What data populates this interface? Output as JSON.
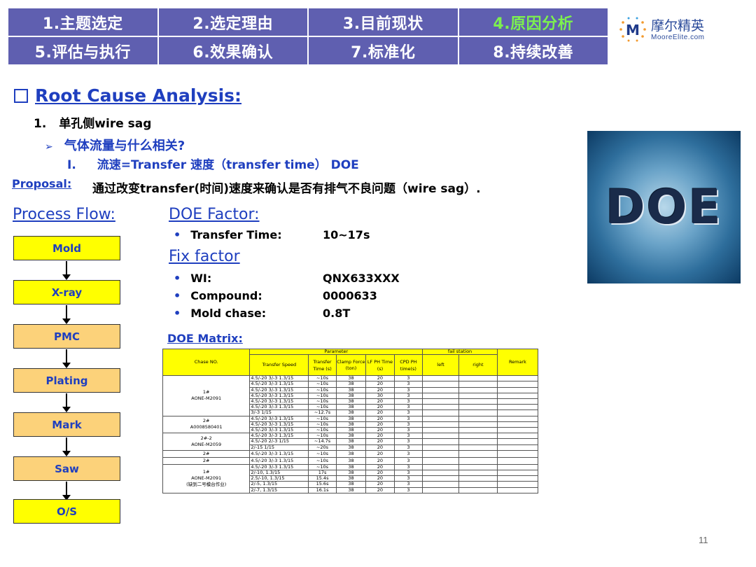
{
  "nav": {
    "row1": [
      "1.主题选定",
      "2.选定理由",
      "3.目前现状",
      "4.原因分析"
    ],
    "row2": [
      "5.评估与执行",
      "6.效果确认",
      "7.标准化",
      "8.持续改善"
    ]
  },
  "brand": {
    "name": "摩尔精英",
    "url": "MooreElite.com",
    "mark": "M"
  },
  "heading": "Root Cause Analysis:",
  "item1": {
    "num": "1.",
    "text": "单孔侧wire sag"
  },
  "item2": {
    "bullet": "➢",
    "text": "气体流量与什么相关?"
  },
  "item3": {
    "num": "I.",
    "text": "流速=Transfer 速度（transfer time） DOE"
  },
  "proposal": {
    "label": "Proposal:",
    "text": "通过改变transfer(时间)速度来确认是否有排气不良问题（wire sag）."
  },
  "doe_image_text": "DOE",
  "process_flow": {
    "title": "Process Flow:",
    "steps": [
      "Mold",
      "X-ray",
      "PMC",
      "Plating",
      "Mark",
      "Saw",
      "O/S"
    ]
  },
  "doe_factor": {
    "title": "DOE Factor:",
    "items": [
      {
        "label": "Transfer Time:",
        "value": "10~17s"
      }
    ]
  },
  "fix_factor": {
    "title": "Fix factor",
    "items": [
      {
        "label": "WI:",
        "value": "QNX633XXX"
      },
      {
        "label": "Compound:",
        "value": "0000633"
      },
      {
        "label": "Mold chase:",
        "value": "0.8T"
      }
    ]
  },
  "matrix": {
    "title": "DOE Matrix:",
    "headers": {
      "chase": "Chase NO.",
      "parameter": "Parameter",
      "fail_station": "fail station",
      "remark": "Remark",
      "transfer_speed": "Transfer Speed",
      "transfer_time": "Transfer Time (s)",
      "clamp_force": "Clamp Force (ton)",
      "lf_ph": "LF PH Time (s)",
      "cpd_ph": "CPD PH time(s)",
      "left": "left",
      "right": "right"
    },
    "chase_groups": [
      {
        "label": "1#\nAONE-M2091",
        "rows": 7
      },
      {
        "label": "2#\nA0008580401",
        "rows": 3
      },
      {
        "label": "2#-2\nAONE-M2059",
        "rows": 3
      },
      {
        "label": "2#",
        "rows": 1
      },
      {
        "label": "2#",
        "rows": 1
      },
      {
        "label": "1#\nAONE-M2091\n(缺到二号模台作业)",
        "rows": 5
      }
    ],
    "rows": [
      [
        "4.5/-20 3/-3 1.3/15",
        "~10s",
        "38",
        "20",
        "3"
      ],
      [
        "4.5/-20 3/-3 1.3/15",
        "~10s",
        "38",
        "20",
        "3"
      ],
      [
        "4.5/-20 3/-3 1.3/15",
        "~10s",
        "38",
        "20",
        "3"
      ],
      [
        "4.5/-20 3/-3 1.3/15",
        "~10s",
        "38",
        "30",
        "3"
      ],
      [
        "4.5/-20 3/-3 1.3/15",
        "~10s",
        "38",
        "20",
        "3"
      ],
      [
        "4.5/-20 3/-3 1.3/15",
        "~10s",
        "38",
        "20",
        "3"
      ],
      [
        "3/-3 1/15",
        "~12.7s",
        "38",
        "20",
        "3"
      ],
      [
        "4.5/-20 3/-3 1.3/15",
        "~10s",
        "38",
        "20",
        "3"
      ],
      [
        "4.5/-20 3/-3 1.3/15",
        "~10s",
        "38",
        "20",
        "3"
      ],
      [
        "4.5/-20 3/-3 1.3/15",
        "~10s",
        "38",
        "20",
        "3"
      ],
      [
        "4.5/-20 3/-3 1.3/15",
        "~10s",
        "38",
        "20",
        "3"
      ],
      [
        "4.5/-20 2/-3 1/15",
        "~14.7s",
        "38",
        "20",
        "3"
      ],
      [
        "2/-15 1/15",
        "~20s",
        "38",
        "20",
        "3"
      ],
      [
        "4.5/-20 3/-3 1.3/15",
        "~10s",
        "38",
        "20",
        "3"
      ],
      [
        "4.5/-20 3/-3 1.3/15",
        "~10s",
        "38",
        "20",
        "3"
      ],
      [
        "4.5/-20 3/-3 1.3/15",
        "~10s",
        "38",
        "20",
        "3"
      ],
      [
        "2/-10, 1.3/15",
        "17s",
        "38",
        "20",
        "3"
      ],
      [
        "2.5/-10, 1.3/15",
        "15.4s",
        "38",
        "20",
        "3"
      ],
      [
        "2/-5, 1.3/15",
        "15.6s",
        "38",
        "20",
        "3"
      ],
      [
        "2/-7, 1.3/15",
        "16.1s",
        "38",
        "20",
        "3"
      ]
    ]
  },
  "page_number": "11",
  "colors": {
    "nav_bg": "#5f5fb0",
    "active": "#7cf04f",
    "accent": "#1f3fbf",
    "flow_yellow": "#ffff00",
    "flow_orange": "#fcd27a"
  }
}
